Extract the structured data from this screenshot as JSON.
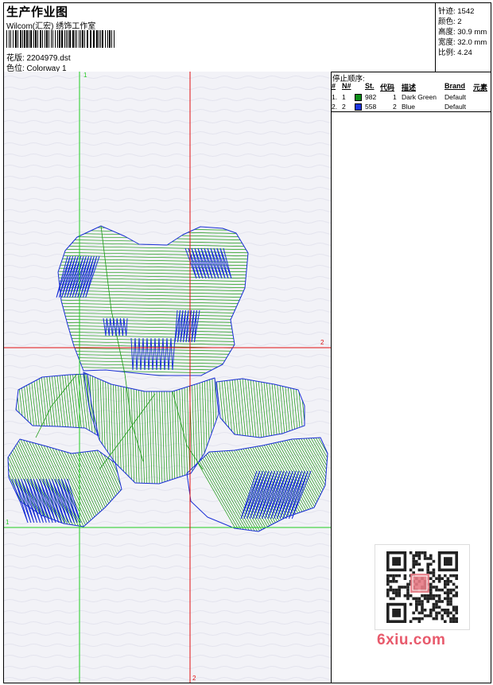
{
  "header": {
    "title": "生产作业图",
    "company": "Wilcom(汇宏) 绣饰工作室",
    "file_label": "花版: 2204979.dst",
    "color_label": "色位: Colorway 1"
  },
  "stats": {
    "stitches": "针迹: 1542",
    "colors": "颜色: 2",
    "height": "高度: 30.9 mm",
    "width": "宽度: 32.0 mm",
    "scale": "比例: 4.24"
  },
  "stop_sequence": {
    "title": "停止顺序:",
    "columns": [
      "#",
      "N#",
      "St.",
      "代码",
      "描述",
      "Brand",
      "元素"
    ],
    "rows": [
      {
        "idx": "1.",
        "n": "1",
        "swatch": "#0d8f19",
        "st": "982",
        "code": "1",
        "desc": "Dark Green",
        "brand": "Default"
      },
      {
        "idx": "2.",
        "n": "2",
        "swatch": "#1c35e0",
        "st": "558",
        "code": "2",
        "desc": "Blue",
        "brand": "Default"
      }
    ]
  },
  "axes": {
    "v1_top": "1",
    "v2_bottom": "2",
    "h2_right": "2",
    "h1_left": "1"
  },
  "colors": {
    "green": "#1a9a12",
    "blue": "#1a2fd6",
    "guide_green": "#22cc22",
    "guide_red": "#e01010"
  },
  "watermark": {
    "text": "6xiu.com"
  }
}
